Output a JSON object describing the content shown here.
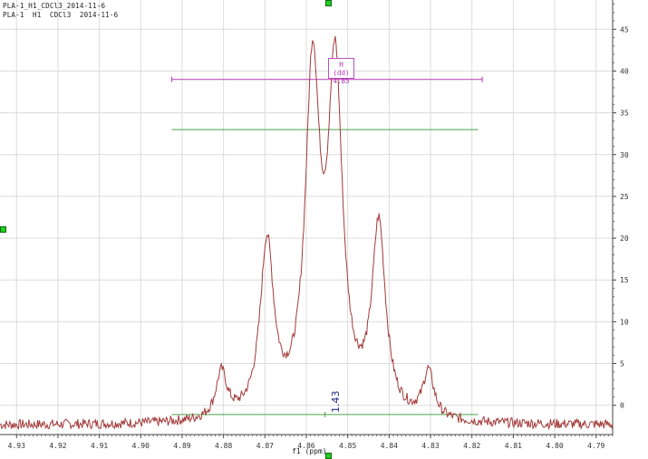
{
  "header": {
    "line1": "PLA-1_H1_CDCl3_2014-11-6",
    "line2": "PLA-1  H1  CDCl3  2014-11-6"
  },
  "multiplet": {
    "label": "H (dd)",
    "shift": "4.85",
    "range_ppm": [
      4.8925,
      4.8175
    ],
    "marker_height": 39
  },
  "integral": {
    "value": "1.43",
    "range_ppm": [
      4.8925,
      4.8185
    ]
  },
  "chart_data": {
    "type": "line",
    "xlabel": "f1 (ppm)",
    "ylabel": "",
    "xlim": [
      4.934,
      4.786
    ],
    "ylim": [
      -3.5,
      48.5
    ],
    "x_reversed": true,
    "x_ticks": [
      4.93,
      4.92,
      4.91,
      4.9,
      4.89,
      4.88,
      4.87,
      4.86,
      4.85,
      4.84,
      4.83,
      4.82,
      4.81,
      4.8,
      4.79
    ],
    "y_ticks": [
      0,
      5,
      10,
      15,
      20,
      25,
      30,
      35,
      40,
      45
    ],
    "grid": true,
    "line_color": "#a33a3a",
    "peaks": [
      {
        "ppm": 4.8805,
        "height": 3.1,
        "width": 0.0016
      },
      {
        "ppm": 4.8695,
        "height": 18.2,
        "width": 0.002
      },
      {
        "ppm": 4.8585,
        "height": 37.8,
        "width": 0.0021
      },
      {
        "ppm": 4.853,
        "height": 37.6,
        "width": 0.0021
      },
      {
        "ppm": 4.8425,
        "height": 20.2,
        "width": 0.002
      },
      {
        "ppm": 4.8305,
        "height": 3.2,
        "width": 0.0016
      }
    ],
    "baseline": -2.4,
    "integral_ref_level": 33.0
  }
}
